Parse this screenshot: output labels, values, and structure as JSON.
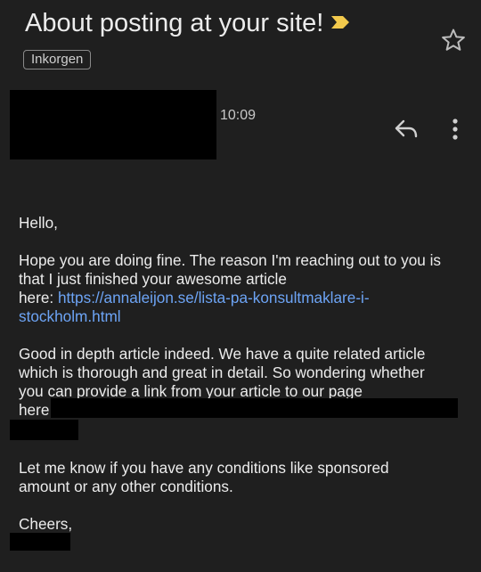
{
  "subject": "About posting at your site!",
  "label": "Inkorgen",
  "time": "10:09",
  "icons": {
    "important": "important-marker-icon",
    "star": "star-icon",
    "reply": "reply-icon",
    "more": "more-vert-icon"
  },
  "colors": {
    "background": "#1f1f1f",
    "link": "#6da4f5",
    "important": "#f2c94c"
  },
  "body": {
    "greeting": "Hello,",
    "p1_line1": "Hope you are doing fine. The reason I'm reaching out to you is",
    "p1_line2": "that I just finished your awesome article",
    "p1_here": "here: ",
    "link_line1": "https://annaleijon.se/lista-pa-konsultmaklare-i-",
    "link_line2": "stockholm.html",
    "p2_line1": "Good in depth article indeed. We have a quite related article",
    "p2_line2": "which is thorough and great in detail.  So wondering whether",
    "p2_line3": "you can provide a link from your article to our page",
    "p2_here": "here",
    "p3_line1": "Let me know if you have any conditions like sponsored",
    "p3_line2": "amount or any other conditions.",
    "closing": "Cheers,"
  }
}
